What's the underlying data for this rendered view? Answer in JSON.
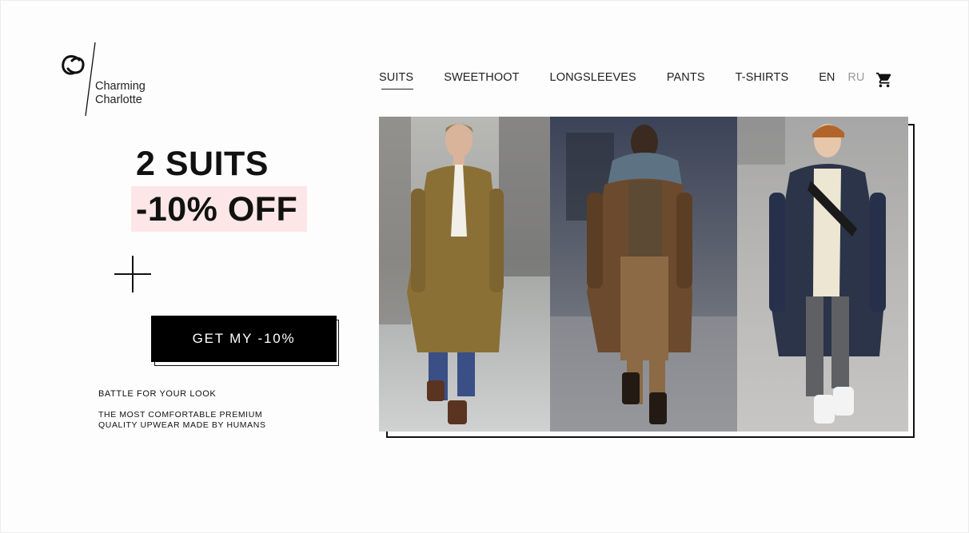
{
  "brand": {
    "line1": "Charming",
    "line2": "Charlotte",
    "logo_icon": "cc-monogram-icon"
  },
  "nav": {
    "items": [
      {
        "label": "SUITS",
        "active": true
      },
      {
        "label": "SWEETHOOT",
        "active": false
      },
      {
        "label": "LONGSLEEVES",
        "active": false
      },
      {
        "label": "PANTS",
        "active": false
      },
      {
        "label": "T-SHIRTS",
        "active": false
      }
    ],
    "languages": [
      {
        "label": "EN",
        "active": true
      },
      {
        "label": "RU",
        "active": false
      }
    ],
    "cart_icon": "shopping-cart-icon"
  },
  "promo": {
    "line1": "2 SUITS",
    "line2": "-10% OFF",
    "highlight_color": "#fde6e7",
    "cta_label": "GET MY -10%",
    "tagline": "BATTLE FOR YOUR LOOK",
    "description": "THE MOST COMFORTABLE PREMIUM QUALITY UPWEAR MADE BY HUMANS"
  },
  "hero": {
    "photos": [
      "model-camel-coat",
      "model-brown-coat",
      "model-navy-coat"
    ]
  }
}
